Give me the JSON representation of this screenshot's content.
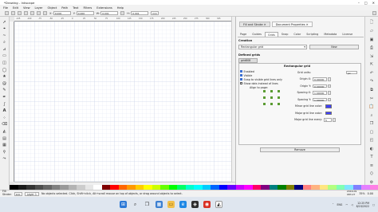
{
  "window": {
    "title": "*Drawing - Inkscape",
    "controls": [
      "–",
      "□",
      "✕"
    ]
  },
  "menu": [
    "File",
    "Edit",
    "View",
    "Layer",
    "Object",
    "Path",
    "Text",
    "Filters",
    "Extensions",
    "Help"
  ],
  "toolbar": {
    "fields": [
      {
        "label": "X:",
        "value": "0.000"
      },
      {
        "label": "Y:",
        "value": "0.000"
      },
      {
        "label": "W:",
        "value": "0.001"
      },
      {
        "label": "H:",
        "value": "0.001"
      }
    ],
    "unit": "mm"
  },
  "ruler": {
    "marks": [
      "-125",
      "-100",
      "-75",
      "-50",
      "-25",
      "0",
      "25",
      "50",
      "75",
      "100",
      "125",
      "150",
      "175",
      "200",
      "225",
      "250",
      "275",
      "300",
      "325"
    ]
  },
  "dock": {
    "tabs": [
      {
        "label": "Fill and Stroke",
        "active": false
      },
      {
        "label": "Document Properties",
        "active": true
      }
    ],
    "subtabs": [
      {
        "label": "Page",
        "active": false
      },
      {
        "label": "Guides",
        "active": false
      },
      {
        "label": "Grids",
        "active": true
      },
      {
        "label": "Snap",
        "active": false
      },
      {
        "label": "Color",
        "active": false
      },
      {
        "label": "Scripting",
        "active": false
      },
      {
        "label": "Metadata",
        "active": false
      },
      {
        "label": "License",
        "active": false
      }
    ],
    "creation": {
      "heading": "Creation",
      "grid_type": "Rectangular grid",
      "new_button": "New"
    },
    "defined": {
      "heading": "Defined grids",
      "grid_id": "grid808",
      "grid_title": "Rectangular grid",
      "checkboxes": [
        {
          "label": "Enabled",
          "checked": true
        },
        {
          "label": "Visible",
          "checked": true
        },
        {
          "label": "Snap to visible grid lines only",
          "checked": true
        },
        {
          "label": "Show dots instead of lines",
          "checked": false
        }
      ],
      "align_label": "Align to page:",
      "grid_units_label": "Grid units:",
      "grid_units_value": "px",
      "fields": [
        {
          "label": "Origin X:",
          "value": "0.00000"
        },
        {
          "label": "Origin Y:",
          "value": "0.00000"
        },
        {
          "label": "Spacing X:",
          "value": "1.00000"
        },
        {
          "label": "Spacing Y:",
          "value": "1.00000"
        }
      ],
      "colors": [
        {
          "label": "Minor grid line color:",
          "color": "#3f3fff"
        },
        {
          "label": "Major grid line color:",
          "color": "#3f3fff"
        }
      ],
      "major_every_label": "Major grid line every:",
      "major_every_value": "5",
      "remove_button": "Remove"
    }
  },
  "status": {
    "fill_label": "Fill:",
    "stroke_label": "Stroke:",
    "opacity": "100",
    "layer": "Layer 1",
    "message": "No objects selected. Click, Shift+click, Alt+scroll mouse on top of objects, or drag around objects to select.",
    "x": "2016.09",
    "y": "983.27",
    "zoom": "35%",
    "rotation": "0.00"
  },
  "taskbar": {
    "time": "12:25 PM",
    "date": "8/19/2022",
    "lang": "ENG"
  },
  "colors": {
    "grid_minor": "#d8def0",
    "grid_major": "#bcc6e4",
    "accent": "#3a6ed1"
  }
}
